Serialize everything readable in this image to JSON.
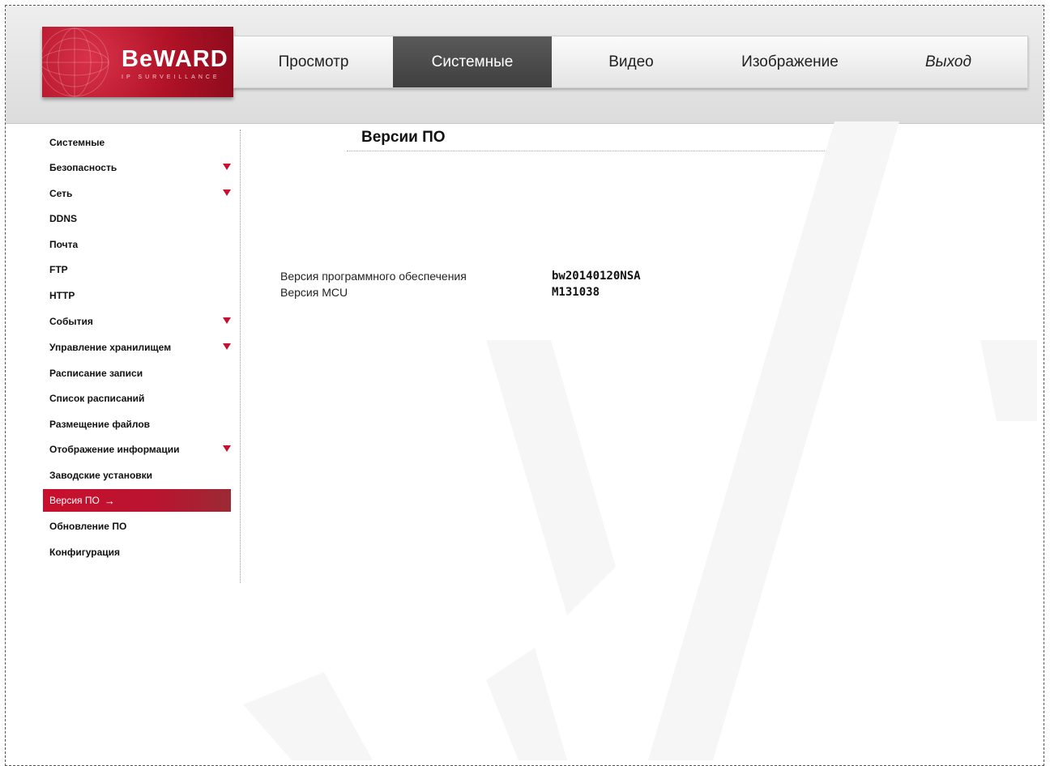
{
  "brand": {
    "logo_text": "BeWARD",
    "logo_sub": "IP SURVEILLANCE",
    "accent": "#c8102e"
  },
  "nav": {
    "items": [
      {
        "label": "Просмотр"
      },
      {
        "label": "Системные",
        "active": true
      },
      {
        "label": "Видео"
      },
      {
        "label": "Изображение"
      },
      {
        "label": "Выход"
      }
    ]
  },
  "sidebar": {
    "items": [
      {
        "label": "Системные"
      },
      {
        "label": "Безопасность",
        "expandable": true
      },
      {
        "label": "Сеть",
        "expandable": true
      },
      {
        "label": "DDNS"
      },
      {
        "label": "Почта"
      },
      {
        "label": "FTP"
      },
      {
        "label": "HTTP"
      },
      {
        "label": "События",
        "expandable": true
      },
      {
        "label": "Управление хранилищем",
        "expandable": true
      },
      {
        "label": "Расписание записи"
      },
      {
        "label": "Список расписаний"
      },
      {
        "label": "Размещение файлов"
      },
      {
        "label": "Отображение информации",
        "expandable": true
      },
      {
        "label": "Заводские установки"
      },
      {
        "label": "Версия ПО",
        "active": true,
        "current_marker": "→"
      },
      {
        "label": "Обновление ПО"
      },
      {
        "label": "Конфигурация"
      }
    ]
  },
  "main": {
    "title": "Версии ПО",
    "rows": [
      {
        "label": "Версия программного обеспечения",
        "value": "bw20140120NSA"
      },
      {
        "label": "Версия MCU",
        "value": "M131038"
      }
    ]
  }
}
